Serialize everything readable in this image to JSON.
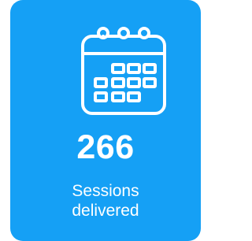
{
  "card": {
    "background_color": "#15a0f5",
    "text_color": "#ffffff",
    "icon": "calendar-icon",
    "value": "266",
    "label_lines": [
      "Sessions",
      "delivered"
    ]
  }
}
